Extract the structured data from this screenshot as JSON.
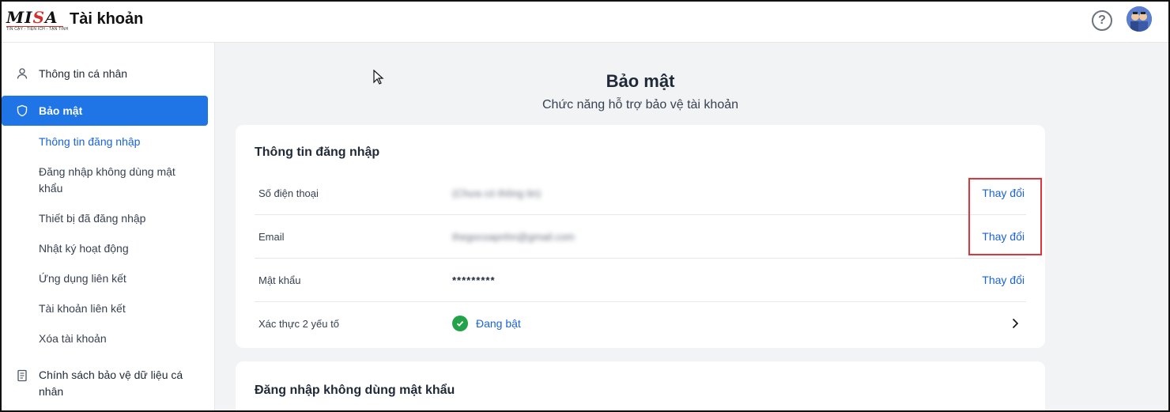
{
  "header": {
    "logo": {
      "text": "MISA",
      "tagline": "TIN CẬY - TIỆN ÍCH - TẬN TÌNH"
    },
    "app_title": "Tài khoản",
    "help_icon": "?"
  },
  "sidebar": {
    "items": [
      {
        "label": "Thông tin cá nhân",
        "icon": "user-icon"
      },
      {
        "label": "Bảo mật",
        "icon": "shield-icon",
        "active": true
      },
      {
        "label": "Chính sách bảo vệ dữ liệu cá nhân",
        "icon": "document-icon"
      }
    ],
    "sub_items": [
      "Thông tin đăng nhập",
      "Đăng nhập không dùng mật khẩu",
      "Thiết bị đã đăng nhập",
      "Nhật ký hoạt động",
      "Ứng dụng liên kết",
      "Tài khoản liên kết",
      "Xóa tài khoản"
    ]
  },
  "main": {
    "title": "Bảo mật",
    "subtitle": "Chức năng hỗ trợ bảo vệ tài khoản",
    "login_card": {
      "title": "Thông tin đăng nhập",
      "rows": [
        {
          "label": "Số điện thoại",
          "value": "(Chưa có thông tin)",
          "action": "Thay đổi"
        },
        {
          "label": "Email",
          "value": "thegocoapnhn@gmail.com",
          "action": "Thay đổi"
        },
        {
          "label": "Mật khẩu",
          "value": "*********",
          "action": "Thay đổi"
        },
        {
          "label": "Xác thực 2 yếu tố",
          "value": "Đang bật"
        }
      ]
    },
    "passwordless_card": {
      "title": "Đăng nhập không dùng mật khẩu"
    }
  },
  "colors": {
    "accent": "#1f75e6",
    "link": "#1a63d6",
    "success": "#22a34a",
    "highlight": "#e0353a",
    "main_bg": "#f2f3f5"
  }
}
